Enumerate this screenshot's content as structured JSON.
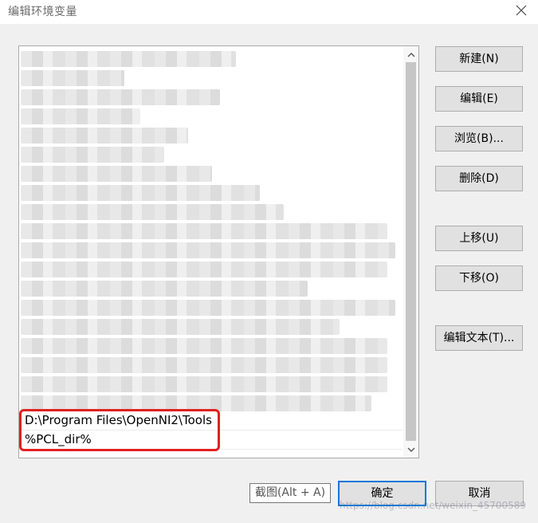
{
  "window": {
    "title": "编辑环境变量"
  },
  "list": {
    "visible_items": [
      "D:\\Program Files\\OpenNI2\\Tools",
      "%PCL_dir%"
    ],
    "highlight_color": "#e02020"
  },
  "side_buttons": [
    {
      "label": "新建(N)"
    },
    {
      "label": "编辑(E)"
    },
    {
      "label": "浏览(B)..."
    },
    {
      "label": "删除(D)"
    },
    {
      "label": "上移(U)"
    },
    {
      "label": "下移(O)"
    },
    {
      "label": "编辑文本(T)..."
    }
  ],
  "footer": {
    "ok_label": "确定",
    "cancel_label": "取消"
  },
  "tooltip": {
    "text": "截图(Alt + A)"
  },
  "watermark": {
    "text": "https://blog.csdn.net/weixin_45700589"
  },
  "colors": {
    "accent": "#0078d7",
    "button_bg": "#e1e1e1",
    "dialog_bg": "#f0f0f0"
  }
}
